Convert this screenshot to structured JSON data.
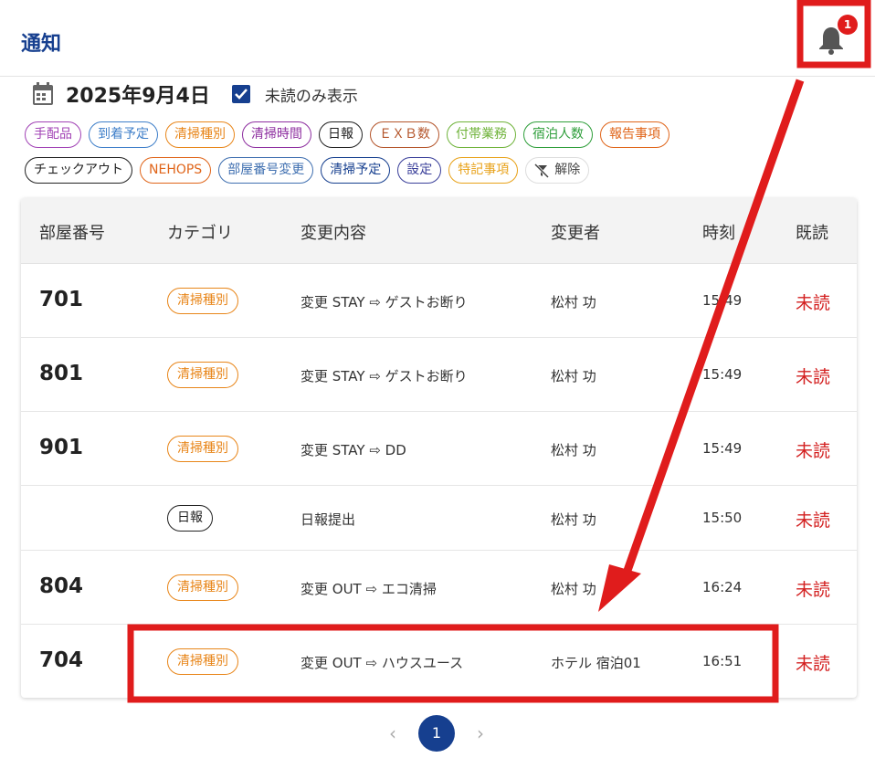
{
  "header": {
    "title": "通知",
    "notification_count": "1"
  },
  "toolbar": {
    "date": "2025年9月4日",
    "unread_only_label": "未読のみ表示",
    "unread_only_checked": true
  },
  "filters": {
    "row1": [
      {
        "label": "手配品",
        "color": "#a142b5"
      },
      {
        "label": "到着予定",
        "color": "#3f7fc9"
      },
      {
        "label": "清掃種別",
        "color": "#e8861a"
      },
      {
        "label": "清掃時間",
        "color": "#8e2fa0"
      },
      {
        "label": "日報",
        "color": "#222222"
      },
      {
        "label": "ＥＸＢ数",
        "color": "#b4552b"
      },
      {
        "label": "付帯業務",
        "color": "#6fb33a"
      },
      {
        "label": "宿泊人数",
        "color": "#2e9e3a"
      },
      {
        "label": "報告事項",
        "color": "#e0651a"
      }
    ],
    "row2": [
      {
        "label": "チェックアウト",
        "color": "#222222"
      },
      {
        "label": "NEHOPS",
        "color": "#e0651a"
      },
      {
        "label": "部屋番号変更",
        "color": "#3f6fb0"
      },
      {
        "label": "清掃予定",
        "color": "#163f8f"
      },
      {
        "label": "設定",
        "color": "#3a3f9a"
      },
      {
        "label": "特記事項",
        "color": "#e8a21a"
      }
    ],
    "clear_label": "解除"
  },
  "table": {
    "headers": [
      "部屋番号",
      "カテゴリ",
      "変更内容",
      "変更者",
      "時刻",
      "既読"
    ],
    "rows": [
      {
        "room": "701",
        "category": "清掃種別",
        "category_color": "#e8861a",
        "change": "変更 STAY ⇨ ゲストお断り",
        "user": "松村 功",
        "time": "15:49",
        "status": "未読"
      },
      {
        "room": "801",
        "category": "清掃種別",
        "category_color": "#e8861a",
        "change": "変更 STAY ⇨ ゲストお断り",
        "user": "松村 功",
        "time": "15:49",
        "status": "未読"
      },
      {
        "room": "901",
        "category": "清掃種別",
        "category_color": "#e8861a",
        "change": "変更 STAY ⇨ DD",
        "user": "松村 功",
        "time": "15:49",
        "status": "未読"
      },
      {
        "room": "",
        "category": "日報",
        "category_color": "#222222",
        "change": "日報提出",
        "user": "松村 功",
        "time": "15:50",
        "status": "未読"
      },
      {
        "room": "804",
        "category": "清掃種別",
        "category_color": "#e8861a",
        "change": "変更 OUT ⇨ エコ清掃",
        "user": "松村 功",
        "time": "16:24",
        "status": "未読"
      },
      {
        "room": "704",
        "category": "清掃種別",
        "category_color": "#e8861a",
        "change": "変更 OUT ⇨ ハウスユース",
        "user": "ホテル 宿泊01",
        "time": "16:51",
        "status": "未読"
      }
    ]
  },
  "pagination": {
    "prev": "‹",
    "current": "1",
    "next": "›"
  },
  "annotation": {
    "color": "#e01c1c"
  },
  "icons": {
    "calendar": "calendar-icon",
    "bell": "bell-icon",
    "filter_clear": "filter-off-icon"
  }
}
